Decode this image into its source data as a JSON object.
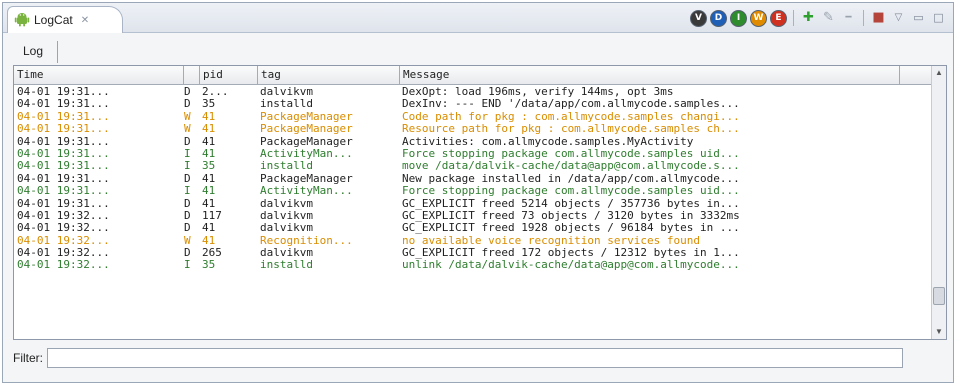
{
  "view": {
    "title": "LogCat",
    "close_glyph": "✕",
    "icon": "android-icon"
  },
  "toolbar": {
    "levels": [
      {
        "letter": "V",
        "name": "verbose",
        "color": "#3a3a3a"
      },
      {
        "letter": "D",
        "name": "debug",
        "color": "#1f5fb5"
      },
      {
        "letter": "I",
        "name": "info",
        "color": "#2e8b2e"
      },
      {
        "letter": "W",
        "name": "warning",
        "color": "#e08a00"
      },
      {
        "letter": "E",
        "name": "error",
        "color": "#d03020"
      }
    ],
    "add_glyph": "✚",
    "edit_glyph": "✎",
    "remove_glyph": "━",
    "clear_glyph": "■",
    "menu_glyph": "▽",
    "minimize_glyph": "▭",
    "maximize_glyph": "□"
  },
  "tabs": {
    "log_label": "Log"
  },
  "table": {
    "headers": {
      "time": "Time",
      "level": "",
      "pid": "pid",
      "tag": "tag",
      "message": "Message"
    },
    "rows": [
      {
        "time": "04-01 19:31...",
        "level": "D",
        "pid": "2...",
        "tag": "dalvikvm",
        "message": "DexOpt: load 196ms, verify 144ms, opt 3ms"
      },
      {
        "time": "04-01 19:31...",
        "level": "D",
        "pid": "35",
        "tag": "installd",
        "message": "DexInv: --- END '/data/app/com.allmycode.samples..."
      },
      {
        "time": "04-01 19:31...",
        "level": "W",
        "pid": "41",
        "tag": "PackageManager",
        "message": "Code path for pkg : com.allmycode.samples changi..."
      },
      {
        "time": "04-01 19:31...",
        "level": "W",
        "pid": "41",
        "tag": "PackageManager",
        "message": "Resource path for pkg : com.allmycode.samples ch..."
      },
      {
        "time": "04-01 19:31...",
        "level": "D",
        "pid": "41",
        "tag": "PackageManager",
        "message": "  Activities: com.allmycode.samples.MyActivity"
      },
      {
        "time": "04-01 19:31...",
        "level": "I",
        "pid": "41",
        "tag": "ActivityMan...",
        "message": "Force stopping package com.allmycode.samples uid..."
      },
      {
        "time": "04-01 19:31...",
        "level": "I",
        "pid": "35",
        "tag": "installd",
        "message": "move /data/dalvik-cache/data@app@com.allmycode.s..."
      },
      {
        "time": "04-01 19:31...",
        "level": "D",
        "pid": "41",
        "tag": "PackageManager",
        "message": "New package installed in /data/app/com.allmycode..."
      },
      {
        "time": "04-01 19:31...",
        "level": "I",
        "pid": "41",
        "tag": "ActivityMan...",
        "message": "Force stopping package com.allmycode.samples uid..."
      },
      {
        "time": "04-01 19:31...",
        "level": "D",
        "pid": "41",
        "tag": "dalvikvm",
        "message": "GC_EXPLICIT freed 5214 objects / 357736 bytes in..."
      },
      {
        "time": "04-01 19:32...",
        "level": "D",
        "pid": "117",
        "tag": "dalvikvm",
        "message": "GC_EXPLICIT freed 73 objects / 3120 bytes in 3332ms"
      },
      {
        "time": "04-01 19:32...",
        "level": "D",
        "pid": "41",
        "tag": "dalvikvm",
        "message": "GC_EXPLICIT freed 1928 objects / 96184 bytes in ..."
      },
      {
        "time": "04-01 19:32...",
        "level": "W",
        "pid": "41",
        "tag": "Recognition...",
        "message": "no available voice recognition services found"
      },
      {
        "time": "04-01 19:32...",
        "level": "D",
        "pid": "265",
        "tag": "dalvikvm",
        "message": "GC_EXPLICIT freed 172 objects / 12312 bytes in 1..."
      },
      {
        "time": "04-01 19:32...",
        "level": "I",
        "pid": "35",
        "tag": "installd",
        "message": "unlink /data/dalvik-cache/data@app@com.allmycode..."
      }
    ]
  },
  "filter": {
    "label": "Filter:",
    "value": "",
    "placeholder": ""
  }
}
